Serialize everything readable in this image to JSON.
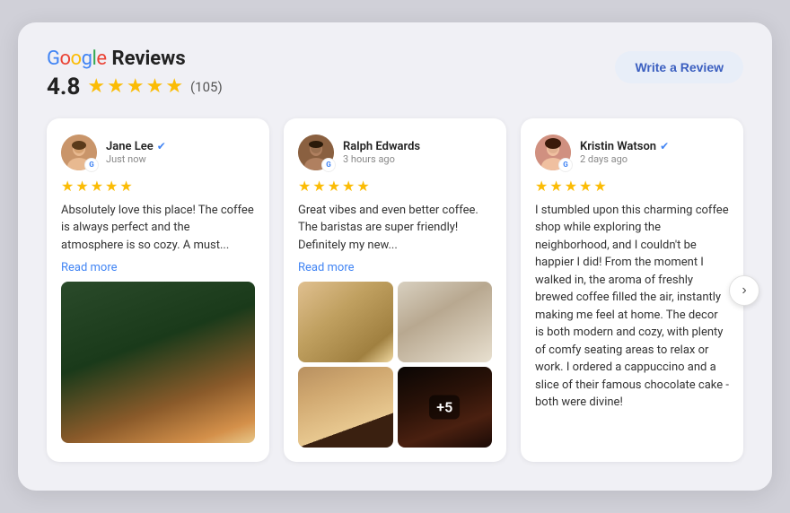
{
  "header": {
    "google_label": "Google",
    "reviews_label": "Reviews",
    "rating": "4.8",
    "review_count": "(105)",
    "write_review_label": "Write a Review",
    "stars": 5
  },
  "reviews": [
    {
      "id": "review-1",
      "reviewer_name": "Jane Lee",
      "verified": true,
      "time": "Just now",
      "stars": 5,
      "text": "Absolutely love this place! The coffee is always perfect and the atmosphere is so cozy. A must...",
      "read_more": "Read more",
      "has_images": true,
      "image_layout": "single"
    },
    {
      "id": "review-2",
      "reviewer_name": "Ralph Edwards",
      "verified": false,
      "time": "3 hours ago",
      "stars": 5,
      "text": "Great vibes and even better coffee. The baristas are super friendly! Definitely my new...",
      "read_more": "Read more",
      "has_images": true,
      "image_layout": "grid4"
    },
    {
      "id": "review-3",
      "reviewer_name": "Kristin Watson",
      "verified": true,
      "time": "2 days ago",
      "stars": 5,
      "text": "I stumbled upon this charming coffee shop while exploring the neighborhood, and I couldn't be happier I did! From the moment I walked in, the aroma of freshly brewed coffee filled the air, instantly making me feel at home. The decor is both modern and cozy, with plenty of comfy seating areas to relax or work. I ordered a cappuccino and a slice of their famous chocolate cake - both were divine!",
      "read_more": null,
      "has_images": false,
      "image_layout": "none"
    }
  ],
  "chevron": "›",
  "plus_badge": "+5"
}
